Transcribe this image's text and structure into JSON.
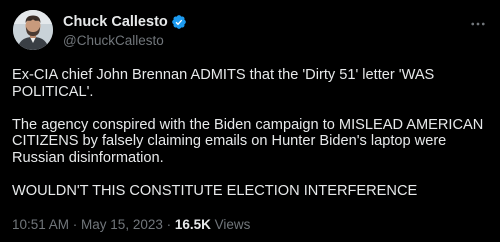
{
  "author": {
    "display_name": "Chuck Callesto",
    "handle": "@ChuckCallesto",
    "verified": true
  },
  "tweet": {
    "paragraphs": [
      "Ex-CIA chief John Brennan ADMITS that the 'Dirty 51' letter 'WAS POLITICAL'.",
      "The agency conspired with the Biden campaign to MISLEAD AMERICAN CITIZENS by falsely claiming emails on Hunter Biden's laptop were Russian disinformation.",
      "WOULDN'T THIS CONSTITUTE ELECTION INTERFERENCE"
    ],
    "time": "10:51 AM",
    "separator": " · ",
    "date": "May 15, 2023",
    "separator2": " · ",
    "views_count": "16.5K",
    "views_label": " Views"
  },
  "colors": {
    "background": "#000000",
    "text_primary": "#e7e9ea",
    "text_secondary": "#71767b",
    "verified_badge": "#1d9bf0"
  },
  "icons": {
    "verified": "verified-badge-icon",
    "more": "more-options-icon"
  }
}
